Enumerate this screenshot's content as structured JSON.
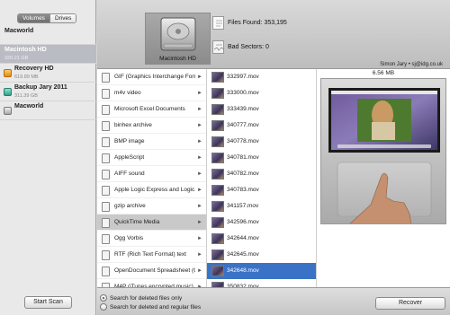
{
  "sidebar": {
    "tabs": [
      {
        "label": "Volumes",
        "active": true
      },
      {
        "label": "Drives",
        "active": false
      }
    ],
    "volumes": [
      {
        "name": "Macworld",
        "sub": "",
        "icon": "none",
        "selected": false,
        "child": false
      },
      {
        "name": "Macintosh HD",
        "sub": "320.21 GB",
        "icon": "none",
        "selected": true,
        "child": false
      },
      {
        "name": "Recovery HD",
        "sub": "619.89 MB",
        "icon": "disk-icon",
        "selected": false,
        "child": true
      },
      {
        "name": "Backup Jary 2011",
        "sub": "311.39 GB",
        "icon": "backup-disk-icon",
        "selected": false,
        "child": true
      },
      {
        "name": "Macworld",
        "sub": "",
        "icon": "macworld-disk-icon",
        "selected": false,
        "child": true
      }
    ],
    "start_scan_label": "Start Scan"
  },
  "header": {
    "drive_label": "Macintosh HD",
    "files_found": "Files Found: 353,195",
    "bad_sectors": "Bad Sectors: 0",
    "user_info": "Simon Jary • sj@idg.co.uk"
  },
  "types": [
    {
      "label": "GIF (Graphics Interchange Format)",
      "selected": false
    },
    {
      "label": "m4v video",
      "selected": false
    },
    {
      "label": "Microsoft Excel Documents",
      "selected": false
    },
    {
      "label": "binhex archive",
      "selected": false
    },
    {
      "label": "BMP image",
      "selected": false
    },
    {
      "label": "AppleScript",
      "selected": false
    },
    {
      "label": "AIFF sound",
      "selected": false
    },
    {
      "label": "Apple Logic Express and Logic...",
      "selected": false
    },
    {
      "label": "gzip archive",
      "selected": false
    },
    {
      "label": "QuickTime Media",
      "selected": true
    },
    {
      "label": "Ogg Vorbis",
      "selected": false
    },
    {
      "label": "RTF (Rich Text Format) text",
      "selected": false
    },
    {
      "label": "OpenDocument Spreadsheet (O...",
      "selected": false
    },
    {
      "label": "M4P (iTunes encrypted music)",
      "selected": false
    }
  ],
  "files": [
    {
      "label": "332997.mov",
      "selected": false
    },
    {
      "label": "333000.mov",
      "selected": false
    },
    {
      "label": "333439.mov",
      "selected": false
    },
    {
      "label": "340777.mov",
      "selected": false
    },
    {
      "label": "340778.mov",
      "selected": false
    },
    {
      "label": "340781.mov",
      "selected": false
    },
    {
      "label": "340782.mov",
      "selected": false
    },
    {
      "label": "340783.mov",
      "selected": false
    },
    {
      "label": "341157.mov",
      "selected": false
    },
    {
      "label": "342596.mov",
      "selected": false
    },
    {
      "label": "342644.mov",
      "selected": false
    },
    {
      "label": "342645.mov",
      "selected": false
    },
    {
      "label": "342648.mov",
      "selected": true
    },
    {
      "label": "350832.mov",
      "selected": false
    }
  ],
  "preview": {
    "size": "6.56 MB"
  },
  "footer": {
    "radio_deleted_only": "Search for deleted files only",
    "radio_deleted_and_regular": "Search for deleted and regular files",
    "selected_radio": 0,
    "recover_label": "Recover"
  },
  "icons": {
    "drive": "hard-drive-icon",
    "files_found": "document-icon",
    "bad_sectors": "damaged-document-icon",
    "type_row": "file-type-icon",
    "file_row": "video-thumbnail-icon",
    "row_arrow": "chevron-right-icon"
  },
  "colors": {
    "selection_blue": "#3a73c6",
    "sidebar_selected": "#b9bcc3",
    "type_selected": "#c9c9c9"
  }
}
